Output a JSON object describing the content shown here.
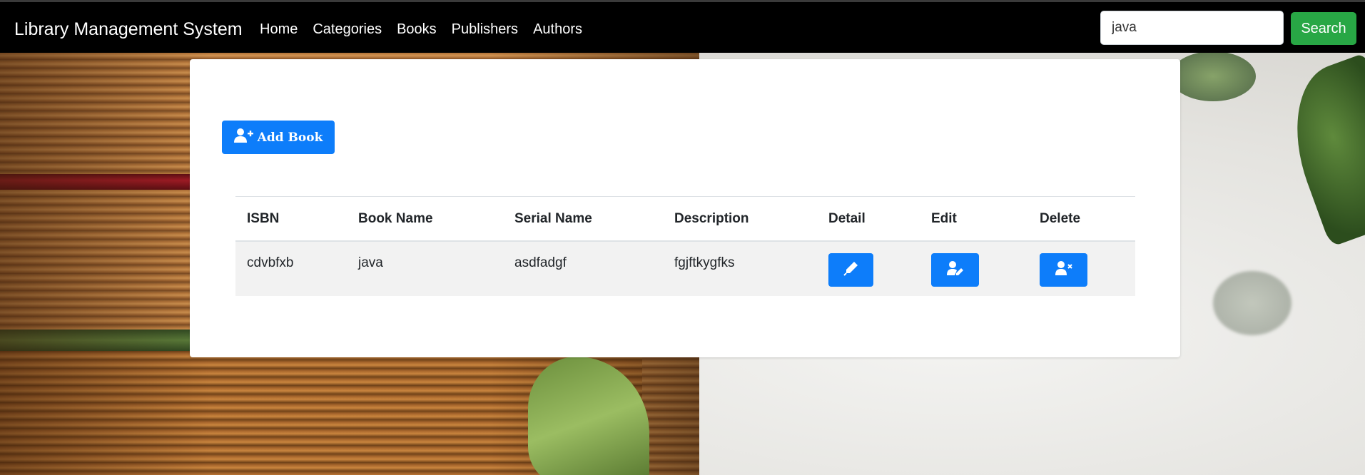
{
  "navbar": {
    "brand": "Library Management System",
    "links": [
      "Home",
      "Categories",
      "Books",
      "Publishers",
      "Authors"
    ],
    "search": {
      "value": "java",
      "button_label": "Search"
    }
  },
  "main": {
    "add_button_label": "Add Book",
    "add_button_icon": "user-plus-icon",
    "table": {
      "headers": [
        "ISBN",
        "Book Name",
        "Serial Name",
        "Description",
        "Detail",
        "Edit",
        "Delete"
      ],
      "rows": [
        {
          "isbn": "cdvbfxb",
          "book_name": "java",
          "serial_name": "asdfadgf",
          "description": "fgjftkygfks",
          "detail_icon": "pen-icon",
          "edit_icon": "user-edit-icon",
          "delete_icon": "user-remove-icon"
        }
      ]
    }
  },
  "colors": {
    "navbar": "#000000",
    "primary_button": "#0d7dfa",
    "search_button": "#28a745",
    "row_background": "#f2f2f2"
  }
}
